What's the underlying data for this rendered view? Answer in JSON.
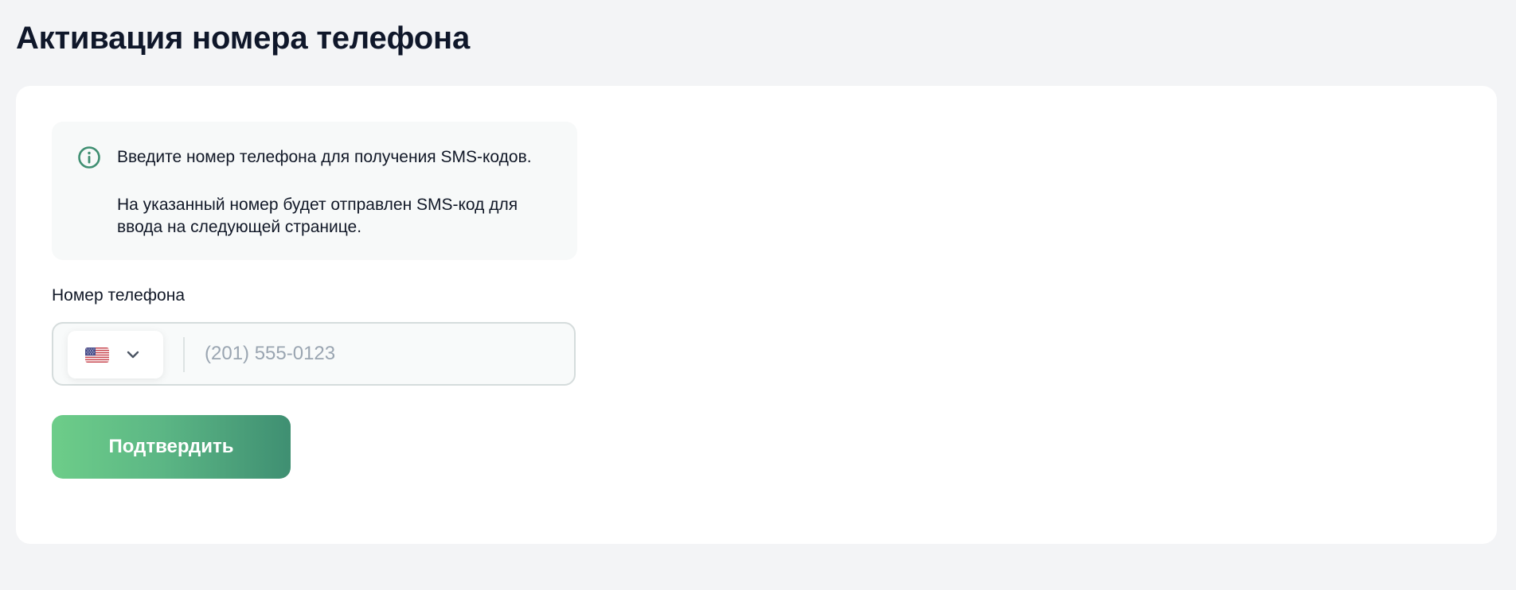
{
  "page": {
    "title": "Активация номера телефона"
  },
  "info": {
    "icon": "info-circle-icon",
    "line1": "Введите номер телефона для получения SMS-кодов.",
    "line2": "На указанный номер будет отправлен SMS-код для ввода на следующей странице."
  },
  "phone": {
    "label": "Номер телефона",
    "country_flag": "us-flag-icon",
    "dropdown_icon": "chevron-down-icon",
    "value": "",
    "placeholder": "(201) 555-0123"
  },
  "actions": {
    "submit_label": "Подтвердить"
  },
  "colors": {
    "background": "#f3f4f6",
    "card": "#ffffff",
    "info_box": "#f7f9f9",
    "accent": "#3f8f72",
    "button_gradient_start": "#6dcd89",
    "button_gradient_end": "#3f8f72"
  }
}
